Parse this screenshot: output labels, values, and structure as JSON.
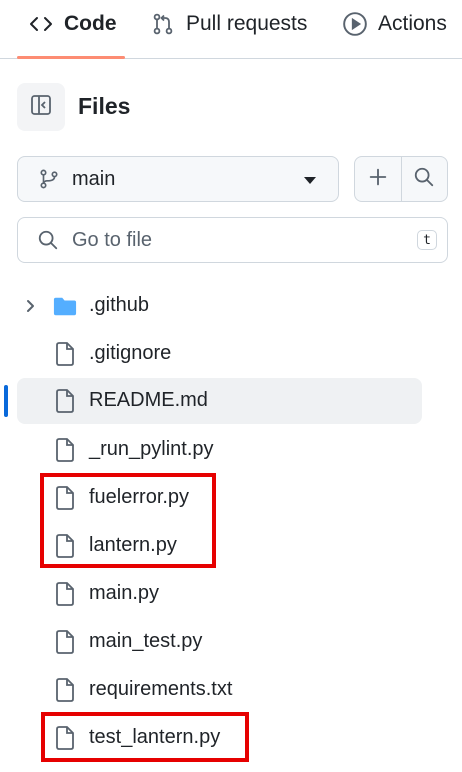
{
  "tabs": [
    {
      "label": "Code",
      "icon": "code-icon",
      "active": true
    },
    {
      "label": "Pull requests",
      "icon": "git-pull-request-icon"
    },
    {
      "label": "Actions",
      "icon": "play-icon"
    }
  ],
  "files_header": {
    "title": "Files",
    "toggle_icon": "sidebar-collapse-icon"
  },
  "branch": {
    "name": "main",
    "icon": "git-branch-icon"
  },
  "actions": {
    "add_icon": "plus-icon",
    "search_icon": "search-icon"
  },
  "search": {
    "placeholder": "Go to file",
    "shortcut": "t"
  },
  "tree": [
    {
      "name": ".github",
      "type": "folder"
    },
    {
      "name": ".gitignore",
      "type": "file"
    },
    {
      "name": "README.md",
      "type": "file",
      "selected": true
    },
    {
      "name": "_run_pylint.py",
      "type": "file"
    },
    {
      "name": "fuelerror.py",
      "type": "file",
      "highlighted": true
    },
    {
      "name": "lantern.py",
      "type": "file",
      "highlighted": true
    },
    {
      "name": "main.py",
      "type": "file"
    },
    {
      "name": "main_test.py",
      "type": "file"
    },
    {
      "name": "requirements.txt",
      "type": "file"
    },
    {
      "name": "test_lantern.py",
      "type": "file",
      "highlighted": true
    }
  ],
  "colors": {
    "accent_underline": "#fd8c73",
    "selection": "#0969da",
    "folder": "#54aeff",
    "highlight": "#e60000"
  }
}
